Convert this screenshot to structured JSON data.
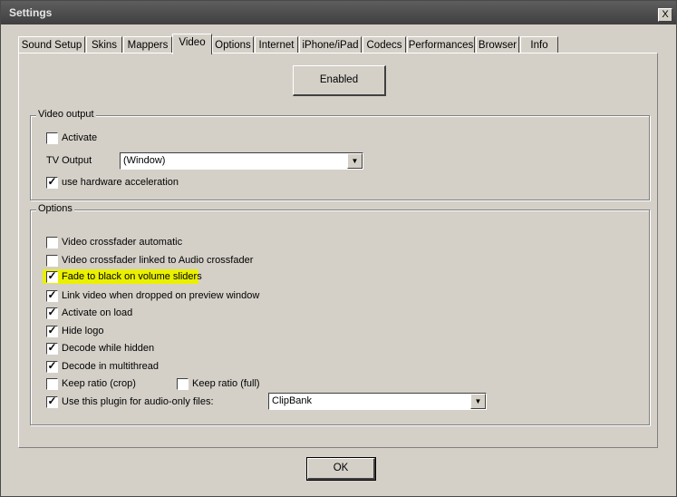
{
  "window": {
    "title": "Settings",
    "close_label": "X"
  },
  "tabs": [
    {
      "label": "Sound Setup"
    },
    {
      "label": "Skins"
    },
    {
      "label": "Mappers"
    },
    {
      "label": "Video"
    },
    {
      "label": "Options"
    },
    {
      "label": "Internet"
    },
    {
      "label": "iPhone/iPad"
    },
    {
      "label": "Codecs"
    },
    {
      "label": "Performances"
    },
    {
      "label": "Browser"
    },
    {
      "label": "Info"
    }
  ],
  "active_tab": "Video",
  "enabled_button": "Enabled",
  "video_output": {
    "title": "Video output",
    "activate": {
      "label": "Activate",
      "checked": false
    },
    "tv_output": {
      "label": "TV Output",
      "value": "(Window)"
    },
    "hw_accel": {
      "label": "use hardware acceleration",
      "checked": true
    }
  },
  "options": {
    "title": "Options",
    "items": [
      {
        "label": "Video crossfader automatic",
        "checked": false
      },
      {
        "label": "Video crossfader linked to Audio crossfader",
        "checked": false
      },
      {
        "label": "Fade to black on volume sliders",
        "checked": true,
        "highlighted": true
      },
      {
        "label": "Link video when dropped on preview window",
        "checked": true
      },
      {
        "label": "Activate on load",
        "checked": true
      },
      {
        "label": "Hide logo",
        "checked": true
      },
      {
        "label": "Decode while hidden",
        "checked": true
      },
      {
        "label": "Decode in multithread",
        "checked": true
      }
    ],
    "keep_ratio_crop": {
      "label": "Keep ratio (crop)",
      "checked": false
    },
    "keep_ratio_full": {
      "label": "Keep ratio (full)",
      "checked": false
    },
    "audio_only_plugin": {
      "label": "Use this plugin for audio-only files:",
      "checked": true,
      "value": "ClipBank"
    }
  },
  "ok_button": "OK",
  "colors": {
    "dialog_bg": "#d4d0c8",
    "highlight": "#eaf000",
    "titlebar": "#4a4a4a"
  }
}
